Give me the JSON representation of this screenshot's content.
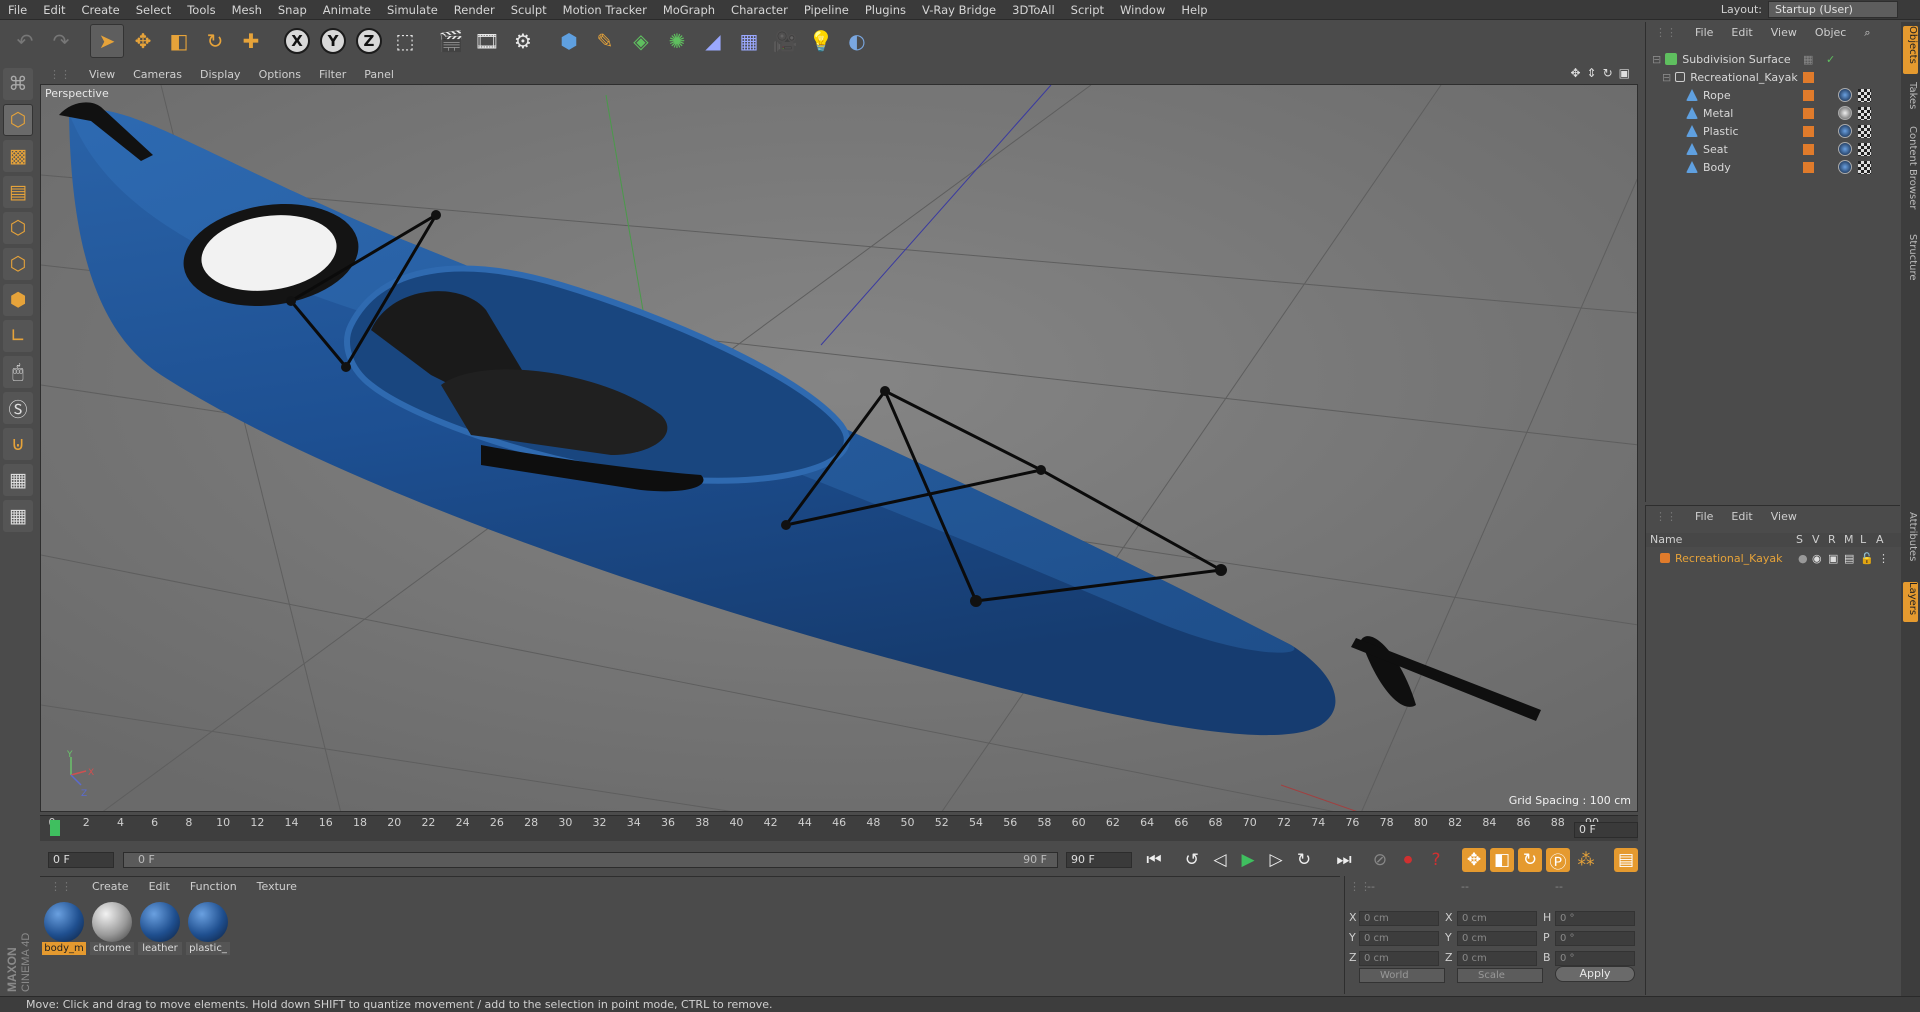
{
  "menubar": {
    "items": [
      "File",
      "Edit",
      "Create",
      "Select",
      "Tools",
      "Mesh",
      "Snap",
      "Animate",
      "Simulate",
      "Render",
      "Sculpt",
      "Motion Tracker",
      "MoGraph",
      "Character",
      "Pipeline",
      "Plugins",
      "V-Ray Bridge",
      "3DToAll",
      "Script",
      "Window",
      "Help"
    ],
    "layout_label": "Layout:",
    "layout_value": "Startup (User)"
  },
  "toolbar": {
    "undo_icon": "undo-icon",
    "redo_icon": "redo-icon",
    "axis_x": "X",
    "axis_y": "Y",
    "axis_z": "Z"
  },
  "viewport": {
    "menu": [
      "View",
      "Cameras",
      "Display",
      "Options",
      "Filter",
      "Panel"
    ],
    "camera_label": "Perspective",
    "grid_spacing": "Grid Spacing : 100 cm",
    "axis_y": "Y",
    "axis_x": "X",
    "axis_z": "Z"
  },
  "timeline": {
    "ticks": [
      "0",
      "2",
      "4",
      "6",
      "8",
      "10",
      "12",
      "14",
      "16",
      "18",
      "20",
      "22",
      "24",
      "26",
      "28",
      "30",
      "32",
      "34",
      "36",
      "38",
      "40",
      "42",
      "44",
      "46",
      "48",
      "50",
      "52",
      "54",
      "56",
      "58",
      "60",
      "62",
      "64",
      "66",
      "68",
      "70",
      "72",
      "74",
      "76",
      "78",
      "80",
      "82",
      "84",
      "86",
      "88",
      "90"
    ],
    "current_frame": "0 F"
  },
  "playback": {
    "start_field": "0 F",
    "scrub_start": "0 F",
    "scrub_end": "90 F",
    "end_field": "90 F"
  },
  "materials": {
    "menu": [
      "Create",
      "Edit",
      "Function",
      "Texture"
    ],
    "items": [
      {
        "label": "body_m",
        "color": "#1f4f8f"
      },
      {
        "label": "chrome",
        "color": "#9a9a9a"
      },
      {
        "label": "leather",
        "color": "#1f4f8f"
      },
      {
        "label": "plastic_",
        "color": "#1f4f8f"
      }
    ]
  },
  "coordinates": {
    "header_dashes": [
      "--",
      "--",
      "--"
    ],
    "rows": [
      {
        "a_label": "X",
        "a_val": "0 cm",
        "b_label": "X",
        "b_val": "0 cm",
        "c_label": "H",
        "c_val": "0 °"
      },
      {
        "a_label": "Y",
        "a_val": "0 cm",
        "b_label": "Y",
        "b_val": "0 cm",
        "c_label": "P",
        "c_val": "0 °"
      },
      {
        "a_label": "Z",
        "a_val": "0 cm",
        "b_label": "Z",
        "b_val": "0 cm",
        "c_label": "B",
        "c_val": "0 °"
      }
    ],
    "mode_world": "World",
    "mode_scale": "Scale",
    "apply": "Apply"
  },
  "object_manager": {
    "menu": [
      "File",
      "Edit",
      "View",
      "Objec"
    ],
    "objects": [
      {
        "name": "Subdivision Surface",
        "icon_color": "#5fbf5f"
      },
      {
        "name": "Recreational_Kayak",
        "icon_color": "#cfcfcf"
      },
      {
        "name": "Rope",
        "icon_color": "#5fa0e0"
      },
      {
        "name": "Metal",
        "icon_color": "#5fa0e0"
      },
      {
        "name": "Plastic",
        "icon_color": "#5fa0e0"
      },
      {
        "name": "Seat",
        "icon_color": "#5fa0e0"
      },
      {
        "name": "Body",
        "icon_color": "#5fa0e0"
      }
    ]
  },
  "layers": {
    "menu": [
      "File",
      "Edit",
      "View"
    ],
    "columns": [
      "Name",
      "S",
      "V",
      "R",
      "M",
      "L",
      "A"
    ],
    "rows": [
      {
        "name": "Recreational_Kayak",
        "color": "#e07b2b"
      }
    ]
  },
  "right_tabs": [
    "Objects",
    "Takes",
    "Content Browser",
    "Structure",
    "Attributes",
    "Layers"
  ],
  "status": "Move: Click and drag to move elements. Hold down SHIFT to quantize movement / add to the selection in point mode, CTRL to remove.",
  "colors": {
    "accent": "#e59a2f",
    "kayak": "#1f4f8f"
  }
}
